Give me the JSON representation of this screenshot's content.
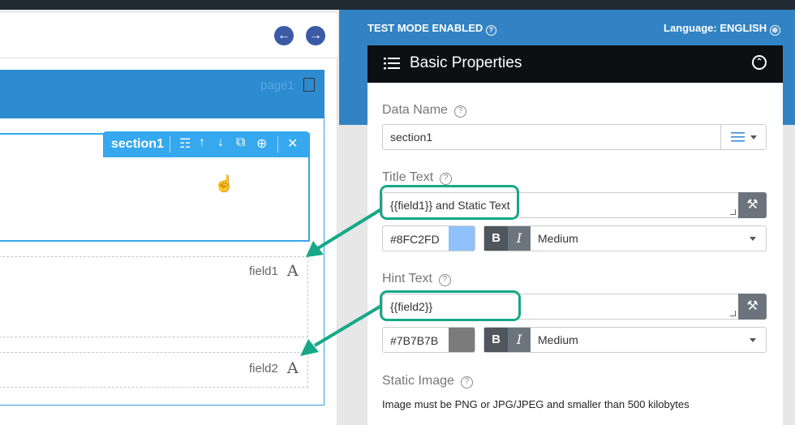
{
  "header": {
    "test_mode": "TEST MODE ENABLED",
    "language": "Language: ENGLISH"
  },
  "canvas": {
    "page_label": "page1",
    "section_label": "section1",
    "fields": [
      {
        "label": "field1"
      },
      {
        "label": "field2"
      }
    ],
    "field_type_glyph": "A"
  },
  "panel": {
    "title": "Basic Properties",
    "data_name": {
      "label": "Data Name",
      "value": "section1"
    },
    "title_text": {
      "label": "Title Text",
      "value": "{{field1}} and Static Text",
      "color": "#8FC2FD",
      "bold": "B",
      "italic": "I",
      "size": "Medium"
    },
    "hint_text": {
      "label": "Hint Text",
      "value": "{{field2}}",
      "color": "#7B7B7B",
      "bold": "B",
      "italic": "I",
      "size": "Medium"
    },
    "static_image": {
      "label": "Static Image",
      "note": "Image must be PNG or JPG/JPEG and smaller than 500 kilobytes"
    }
  },
  "colors": {
    "header_blue": "#3283c3",
    "accent_blue": "#36a8ee",
    "highlight_green": "#16a888",
    "title_swatch": "#8FC2FD",
    "hint_swatch": "#7B7B7B"
  }
}
